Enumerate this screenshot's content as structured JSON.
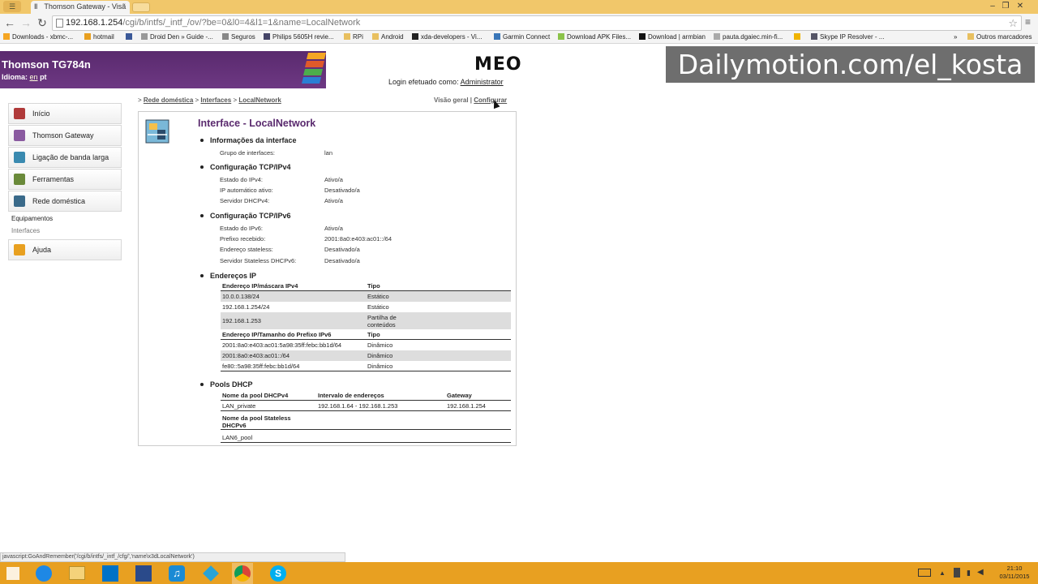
{
  "browser": {
    "tab_title": "Thomson Gateway - Visã",
    "url_host": "192.168.1.254",
    "url_path": "/cgi/b/intfs/_intf_/ov/?be=0&l0=4&l1=1&name=LocalNetwork",
    "bookmarks": [
      "Downloads - xbmc-...",
      "hotmail",
      "Droid Den » Guide -...",
      "Seguros",
      "Philips 5605H revie...",
      "RPi",
      "Android",
      "xda-developers - Vi...",
      "Garmin Connect",
      "Download APK Files...",
      "Download | armbian",
      "pauta.dgaiec.min-fi...",
      "Skype IP Resolver - ...",
      "»",
      "Outros marcadores"
    ],
    "status_bar": "javascript:GoAndRemember('/cgi/b/intfs/_intf_/cfg/','name\\x3dLocalNetwork')"
  },
  "header": {
    "device": "Thomson TG784n",
    "lang_label": "Idioma:",
    "lang_en": "en",
    "lang_pt": "pt",
    "logo": "MEO",
    "login_label": "Login efetuado como:",
    "login_user": "Administrator"
  },
  "watermark": "Dailymotion.com/el_kosta",
  "sidebar": {
    "items": [
      "Início",
      "Thomson Gateway",
      "Ligação de banda larga",
      "Ferramentas",
      "Rede doméstica"
    ],
    "sub_items": [
      "Equipamentos",
      "Interfaces"
    ],
    "help": "Ajuda"
  },
  "breadcrumb": {
    "prefix": ">",
    "items": [
      "Rede doméstica",
      "Interfaces",
      "LocalNetwork"
    ],
    "sep": ">",
    "view": "Visão geral",
    "bar": "|",
    "configure": "Configurar"
  },
  "page": {
    "title": "Interface - LocalNetwork",
    "info": {
      "heading": "Informações da interface",
      "rows": [
        {
          "k": "Grupo de interfaces:",
          "v": "lan"
        }
      ]
    },
    "ipv4": {
      "heading": "Configuração TCP/IPv4",
      "rows": [
        {
          "k": "Estado do IPv4:",
          "v": "Ativo/a"
        },
        {
          "k": "IP automático ativo:",
          "v": "Desativado/a"
        },
        {
          "k": "Servidor DHCPv4:",
          "v": "Ativo/a"
        }
      ]
    },
    "ipv6": {
      "heading": "Configuração TCP/IPv6",
      "rows": [
        {
          "k": "Estado do IPv6:",
          "v": "Ativo/a"
        },
        {
          "k": "Prefixo recebido:",
          "v": "2001:8a0:e403:ac01::/64"
        },
        {
          "k": "Endereço stateless:",
          "v": "Desativado/a"
        },
        {
          "k": "Servidor Stateless DHCPv6:",
          "v": "Desativado/a"
        }
      ]
    },
    "addresses": {
      "heading": "Endereços IP",
      "ipv4_head": [
        "Endereço IP/máscara IPv4",
        "Tipo"
      ],
      "ipv4_rows": [
        [
          "10.0.0.138/24",
          "Estático"
        ],
        [
          "192.168.1.254/24",
          "Estático"
        ],
        [
          "192.168.1.253",
          "Partilha de conteúdos"
        ]
      ],
      "ipv6_head": [
        "Endereço IP/Tamanho do Prefixo IPv6",
        "Tipo"
      ],
      "ipv6_rows": [
        [
          "2001:8a0:e403:ac01:5a98:35ff:febc:bb1d/64",
          "Dinâmico"
        ],
        [
          "2001:8a0:e403:ac01::/64",
          "Dinâmico"
        ],
        [
          "fe80::5a98:35ff:febc:bb1d/64",
          "Dinâmico"
        ]
      ]
    },
    "dhcp": {
      "heading": "Pools DHCP",
      "v4_head": [
        "Nome da pool DHCPv4",
        "Intervalo de endereços",
        "Gateway"
      ],
      "v4_rows": [
        [
          "LAN_private",
          "192.168.1.64 - 192.168.1.253",
          "192.168.1.254"
        ]
      ],
      "v6_head": "Nome da pool Stateless DHCPv6",
      "v6_rows": [
        "LAN6_pool"
      ]
    }
  },
  "taskbar": {
    "time": "21:10",
    "date": "03/11/2015"
  },
  "colors": {
    "purple": "#5a2a6e",
    "titlebar": "#f1c76a",
    "taskbar": "#e8a021"
  }
}
